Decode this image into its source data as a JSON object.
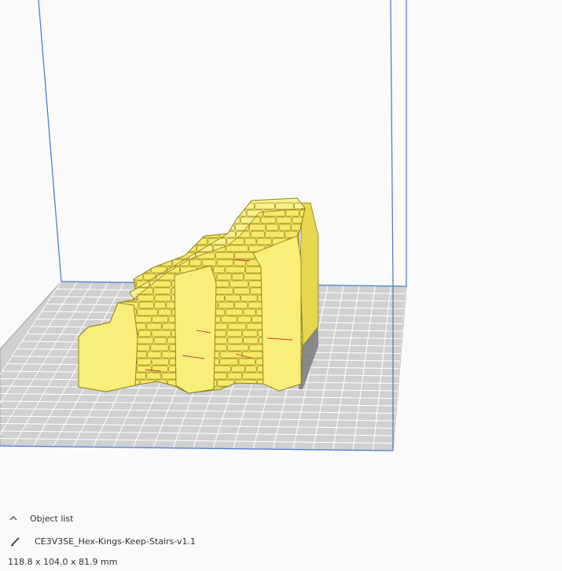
{
  "viewport": {
    "build_volume_color": "#4a7fd6",
    "plate_color": "#c8c8c8",
    "grid_color": "#ffffff",
    "model_color": "#f7e967",
    "model_shadow_color": "#c9b92e",
    "model_outline_color": "#8a7d1c"
  },
  "object_list": {
    "header_label": "Object list",
    "header_icon": "chevron-up-icon",
    "items": [
      {
        "name": "CE3V3SE_Hex-Kings-Keep-Stairs-v1.1",
        "icon": "pencil-icon"
      }
    ],
    "dimensions": "118.8 x 104.0 x 81.9 mm"
  }
}
